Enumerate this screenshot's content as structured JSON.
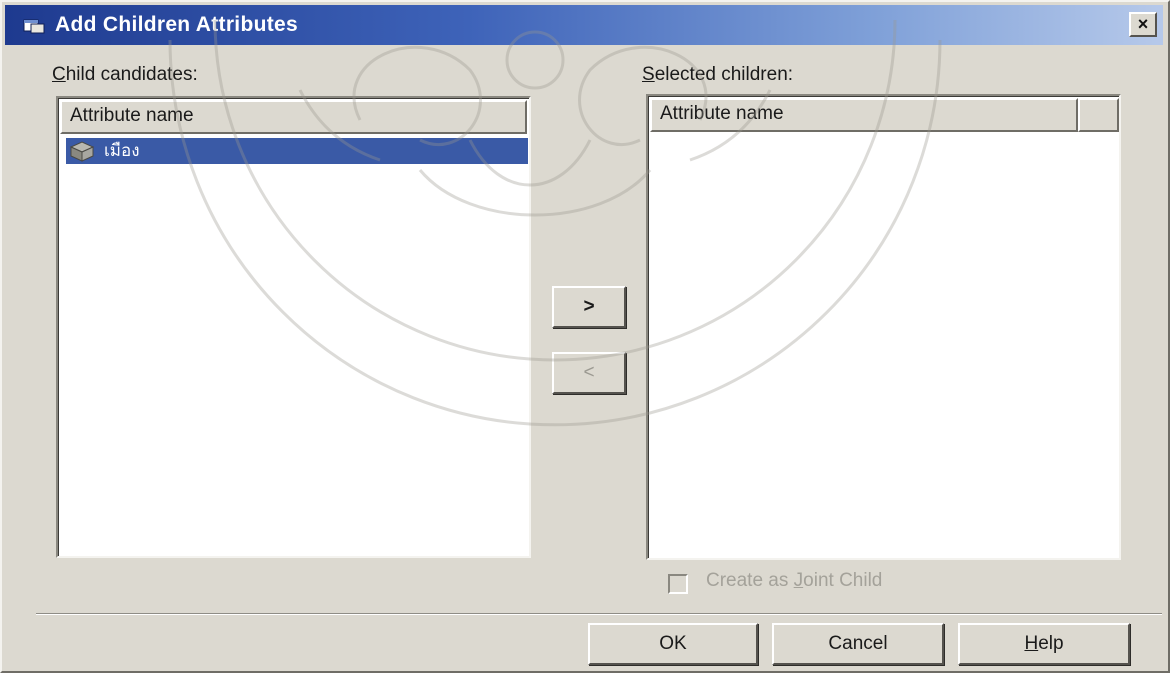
{
  "dialog": {
    "title": "Add Children Attributes",
    "close_label": "×"
  },
  "candidates": {
    "label_accel": "C",
    "label_rest": "hild candidates:",
    "column_header": "Attribute name",
    "items": [
      {
        "label": "เมือง",
        "selected": true,
        "icon": "cube-icon"
      }
    ]
  },
  "selected": {
    "label_accel": "S",
    "label_rest": "elected children:",
    "column_header": "Attribute name"
  },
  "transfer": {
    "add_label": ">",
    "remove_label": "<"
  },
  "options": {
    "joint_child_before": "Create as ",
    "joint_child_accel": "J",
    "joint_child_after": "oint Child",
    "joint_child_checked": false,
    "joint_child_enabled": false
  },
  "footer": {
    "ok_label": "OK",
    "cancel_label": "Cancel",
    "help_accel": "H",
    "help_rest": "elp"
  },
  "colors": {
    "title_bar": "#1e3a8f",
    "selection": "#3a5aa6",
    "face": "#dcd9d0"
  }
}
